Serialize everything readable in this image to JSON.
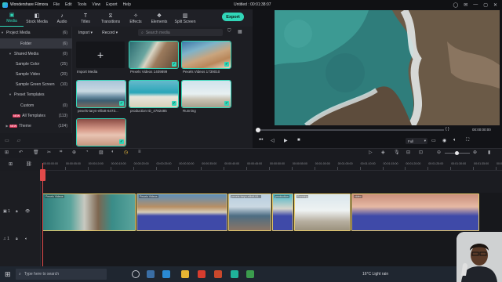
{
  "app": {
    "name": "Wondershare Filmora",
    "menu": [
      "File",
      "Edit",
      "Tools",
      "View",
      "Export",
      "Help"
    ],
    "project_title": "Untitled : 00:01:38:07"
  },
  "toolbar": {
    "tabs": [
      {
        "icon": "media-icon",
        "label": "Media"
      },
      {
        "icon": "stock-media-icon",
        "label": "Stock Media"
      },
      {
        "icon": "audio-icon",
        "label": "Audio"
      },
      {
        "icon": "titles-icon",
        "label": "Titles"
      },
      {
        "icon": "transitions-icon",
        "label": "Transitions"
      },
      {
        "icon": "effects-icon",
        "label": "Effects"
      },
      {
        "icon": "elements-icon",
        "label": "Elements"
      },
      {
        "icon": "split-screen-icon",
        "label": "Split Screen"
      }
    ],
    "active": "Media",
    "export_label": "Export"
  },
  "sidebar": {
    "items": [
      {
        "label": "Project Media",
        "count": "(6)"
      },
      {
        "label": "Folder",
        "count": "(6)"
      },
      {
        "label": "Shared Media",
        "count": "(0)"
      },
      {
        "label": "Sample Color",
        "count": "(25)"
      },
      {
        "label": "Sample Video",
        "count": "(20)"
      },
      {
        "label": "Sample Green Screen",
        "count": "(10)"
      },
      {
        "label": "Preset Templates",
        "count": ""
      },
      {
        "label": "Custom",
        "count": "(0)"
      },
      {
        "label": "All Templates",
        "count": "(113)"
      },
      {
        "label": "Theme",
        "count": "(104)"
      }
    ],
    "badge": "NEW"
  },
  "media": {
    "import_label": "Import",
    "record_label": "Record",
    "search_placeholder": "Search media",
    "import_tile_label": "Import Media",
    "clips": [
      {
        "caption": "Pexels Videos 1409899"
      },
      {
        "caption": "Pexels Videos 1739010"
      },
      {
        "caption": "pexels-taryn-elliott-6473..."
      },
      {
        "caption": "production ID_4782485"
      },
      {
        "caption": "Running"
      },
      {
        "caption": ""
      }
    ]
  },
  "preview": {
    "timecode": "00:00:00:00",
    "brackets": "{    }",
    "quality": "Full",
    "progress": 0
  },
  "ruler": {
    "ticks": [
      "00:00:00:00",
      "00:00:05:00",
      "00:00:10:00",
      "00:00:15:00",
      "00:00:20:00",
      "00:00:25:00",
      "00:00:30:00",
      "00:00:35:00",
      "00:00:40:00",
      "00:00:45:00",
      "00:00:50:00",
      "00:00:55:00",
      "00:01:00:00",
      "00:01:05:00",
      "00:01:10:00",
      "00:01:15:00",
      "00:01:20:00",
      "00:01:25:00",
      "00:01:30:00",
      "00:01:35:00",
      "00:01:40:00"
    ]
  },
  "timeline": {
    "video_track": "1",
    "audio_track": "1",
    "clip_labels": [
      "Pexels Videos",
      "Pexels Videos",
      "pexels-taryn-elliott-64...",
      "production",
      "Running",
      "video"
    ]
  },
  "taskbar": {
    "search_placeholder": "Type here to search",
    "weather": "16°C  Light rain"
  }
}
